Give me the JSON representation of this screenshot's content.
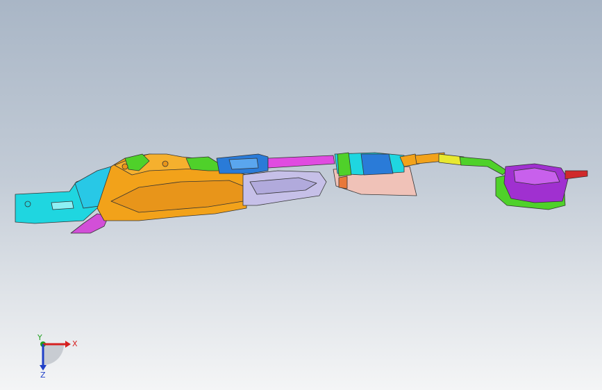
{
  "viewport": {
    "background_top": "#a9b6c6",
    "background_bottom": "#f4f5f6"
  },
  "model": {
    "description_colors": {
      "cyan": "#1fd6e0",
      "orange": "#f2a21a",
      "lavender": "#c6c0e8",
      "magenta": "#e04be0",
      "green": "#4fd12a",
      "blue": "#2a7bd8",
      "pink": "#f0c2b8",
      "purple": "#a030d0",
      "red": "#d02a2a",
      "yellow": "#e8e830"
    }
  },
  "triad": {
    "x_label": "X",
    "y_label": "Y",
    "z_label": "Z",
    "x_color": "#d62020",
    "y_color": "#20a020",
    "z_color": "#2040c8"
  }
}
